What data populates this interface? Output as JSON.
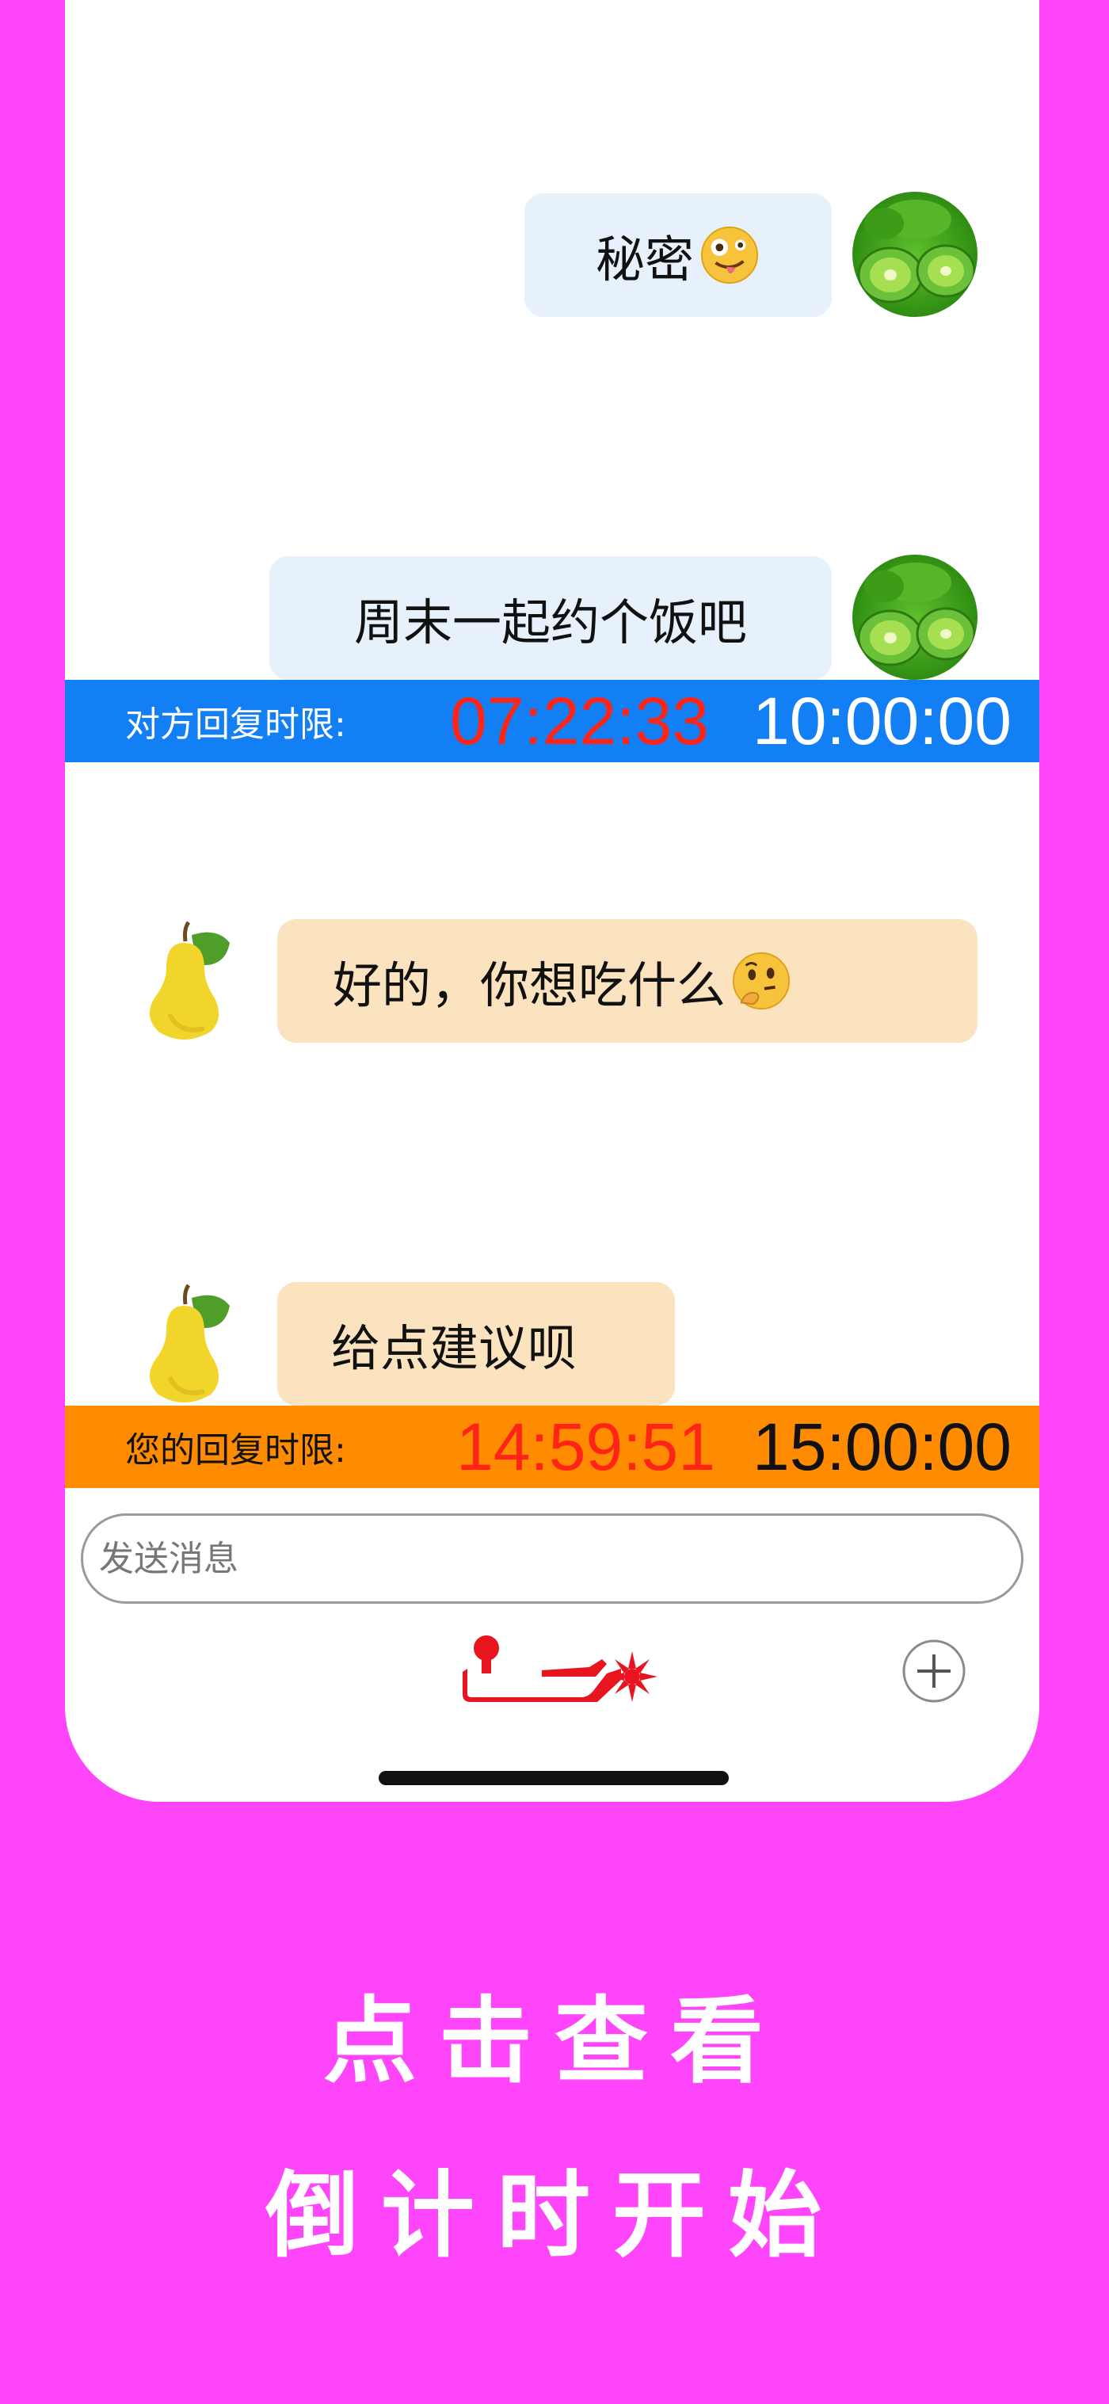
{
  "chat": {
    "messages": [
      {
        "sender": "me",
        "avatar": "kiwi-icon",
        "text": "秘密",
        "emoji": "zany-face-emoji"
      },
      {
        "sender": "me",
        "avatar": "kiwi-icon",
        "text": "周末一起约个饭吧"
      },
      {
        "sender": "other",
        "avatar": "pear-icon",
        "text": "好的，你想吃什么",
        "emoji": "thinking-face-emoji"
      },
      {
        "sender": "other",
        "avatar": "pear-icon",
        "text": "给点建议呗"
      }
    ]
  },
  "timers": {
    "other": {
      "label": "对方回复时限:",
      "remaining": "07:22:33",
      "total": "10:00:00",
      "color": "#127ff5"
    },
    "mine": {
      "label": "您的回复时限:",
      "remaining": "14:59:51",
      "total": "15:00:00",
      "color": "#ff8c00"
    }
  },
  "composer": {
    "placeholder": "发送消息",
    "action_icon": "spur-icon",
    "add_icon": "plus-circle-icon"
  },
  "promo": {
    "line1": "点击查看",
    "line2": "倒计时开始"
  },
  "colors": {
    "background": "#ff45fa",
    "my_bubble": "#e6f1fb",
    "their_bubble": "#fbe3c0",
    "remaining_time": "#ff2418",
    "spur": "#e8141f"
  }
}
